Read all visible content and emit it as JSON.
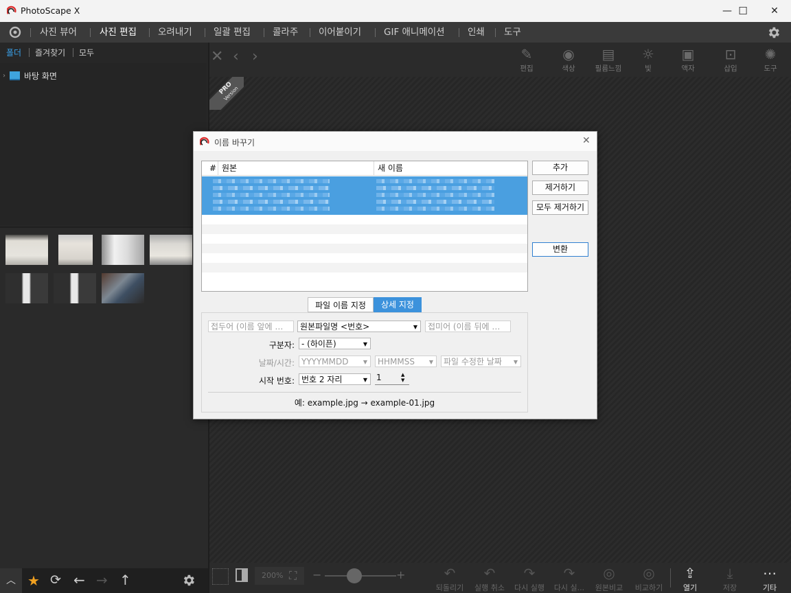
{
  "app": {
    "title": "PhotoScape X"
  },
  "window_controls": {
    "minimize": "—",
    "maximize": "☐",
    "close": "✕"
  },
  "menu": [
    "사진 뷰어",
    "사진 편집",
    "오려내기",
    "일괄 편집",
    "콜라주",
    "이어붙이기",
    "GIF 애니메이션",
    "인쇄",
    "도구"
  ],
  "menu_active": "사진 편집",
  "left_panel": {
    "tabs": [
      "폴더",
      "즐겨찾기",
      "모두"
    ],
    "tree_item": "바탕 화면"
  },
  "top_tools": [
    "편집",
    "색상",
    "필름느낌",
    "빛",
    "액자",
    "삽입",
    "도구"
  ],
  "pro_badge": {
    "line1": "PRO",
    "line2": "Version"
  },
  "bottom_tools": {
    "zoom": "200%",
    "items": [
      "되돌리기",
      "실행 취소",
      "다시 실행",
      "다시 실...",
      "원본비교",
      "비교하기",
      "열기",
      "저장",
      "기타"
    ]
  },
  "dialog": {
    "title": "이름 바꾸기",
    "columns": {
      "num": "#",
      "original": "원본",
      "new_name": "새 이름"
    },
    "buttons": {
      "add": "추가",
      "remove": "제거하기",
      "remove_all": "모두 제거하기",
      "convert": "변환"
    },
    "segments": {
      "file_name": "파일 이름 지정",
      "detail": "상세 지정"
    },
    "prefix_placeholder": "접두어 (이름 앞에 …",
    "base_name": "원본파일명 <번호>",
    "suffix_placeholder": "접미어 (이름 뒤에 …",
    "separator_label": "구분자:",
    "separator_value": "- (하이픈)",
    "datetime_label": "날짜/시간:",
    "date_format": "YYYYMMDD",
    "time_format": "HHMMSS",
    "date_source": "파일 수정한 날짜",
    "start_label": "시작 번호:",
    "digits_value": "번호 2 자리",
    "start_value": "1",
    "example": "예: example.jpg → example-01.jpg"
  }
}
